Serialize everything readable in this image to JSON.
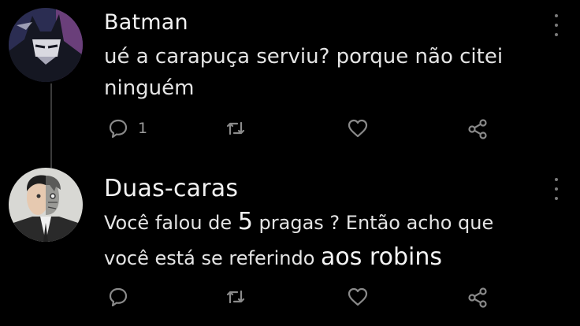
{
  "comments": [
    {
      "author": "Batman",
      "text_lines": [
        "ué a carapuça serviu? porque não citei",
        "ninguém"
      ],
      "reply_count": "1"
    },
    {
      "author": "Duas-caras",
      "text_line1_a": "Você falou de ",
      "text_line1_b": "5",
      "text_line1_c": " pragas ? Então acho que",
      "text_line2_a": "você está se referindo ",
      "text_line2_b": "aos robins"
    }
  ],
  "colors": {
    "background": "#000000",
    "text": "#e4e4e4",
    "icon": "#8a8a8a"
  },
  "icons": [
    "reply-icon",
    "retweet-icon",
    "heart-icon",
    "share-icon",
    "more-icon"
  ]
}
